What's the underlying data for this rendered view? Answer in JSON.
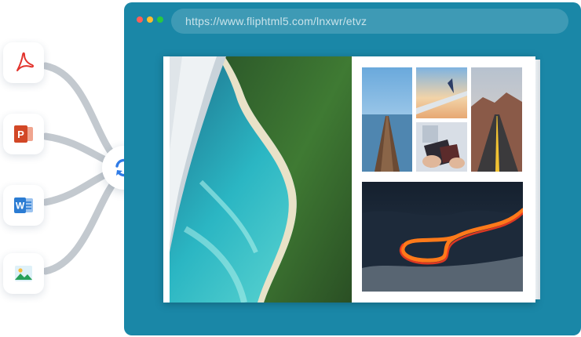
{
  "browser": {
    "url": "https://www.fliphtml5.com/lnxwr/etvz",
    "window_controls": [
      {
        "name": "close",
        "color": "#ff5f57"
      },
      {
        "name": "minimize",
        "color": "#febc2e"
      },
      {
        "name": "maximize",
        "color": "#28c840"
      }
    ],
    "frame_color": "#1a87a7"
  },
  "sources": [
    {
      "type": "pdf",
      "icon": "pdf-icon",
      "color": "#e2342d"
    },
    {
      "type": "powerpoint",
      "icon": "powerpoint-icon",
      "color": "#d24726"
    },
    {
      "type": "word",
      "icon": "word-icon",
      "color": "#2b7cd3"
    },
    {
      "type": "image",
      "icon": "image-icon",
      "color": "#27a05a"
    }
  ],
  "converter": {
    "icon": "sync-icon",
    "color": "#2f7be6"
  },
  "book": {
    "left_page": {
      "image": "aerial-beach-photo"
    },
    "right_page": {
      "images": [
        "pier-lake-photo",
        "airplane-wing-photo",
        "desert-road-photo",
        "passport-photo",
        "night-highway-photo"
      ]
    }
  }
}
